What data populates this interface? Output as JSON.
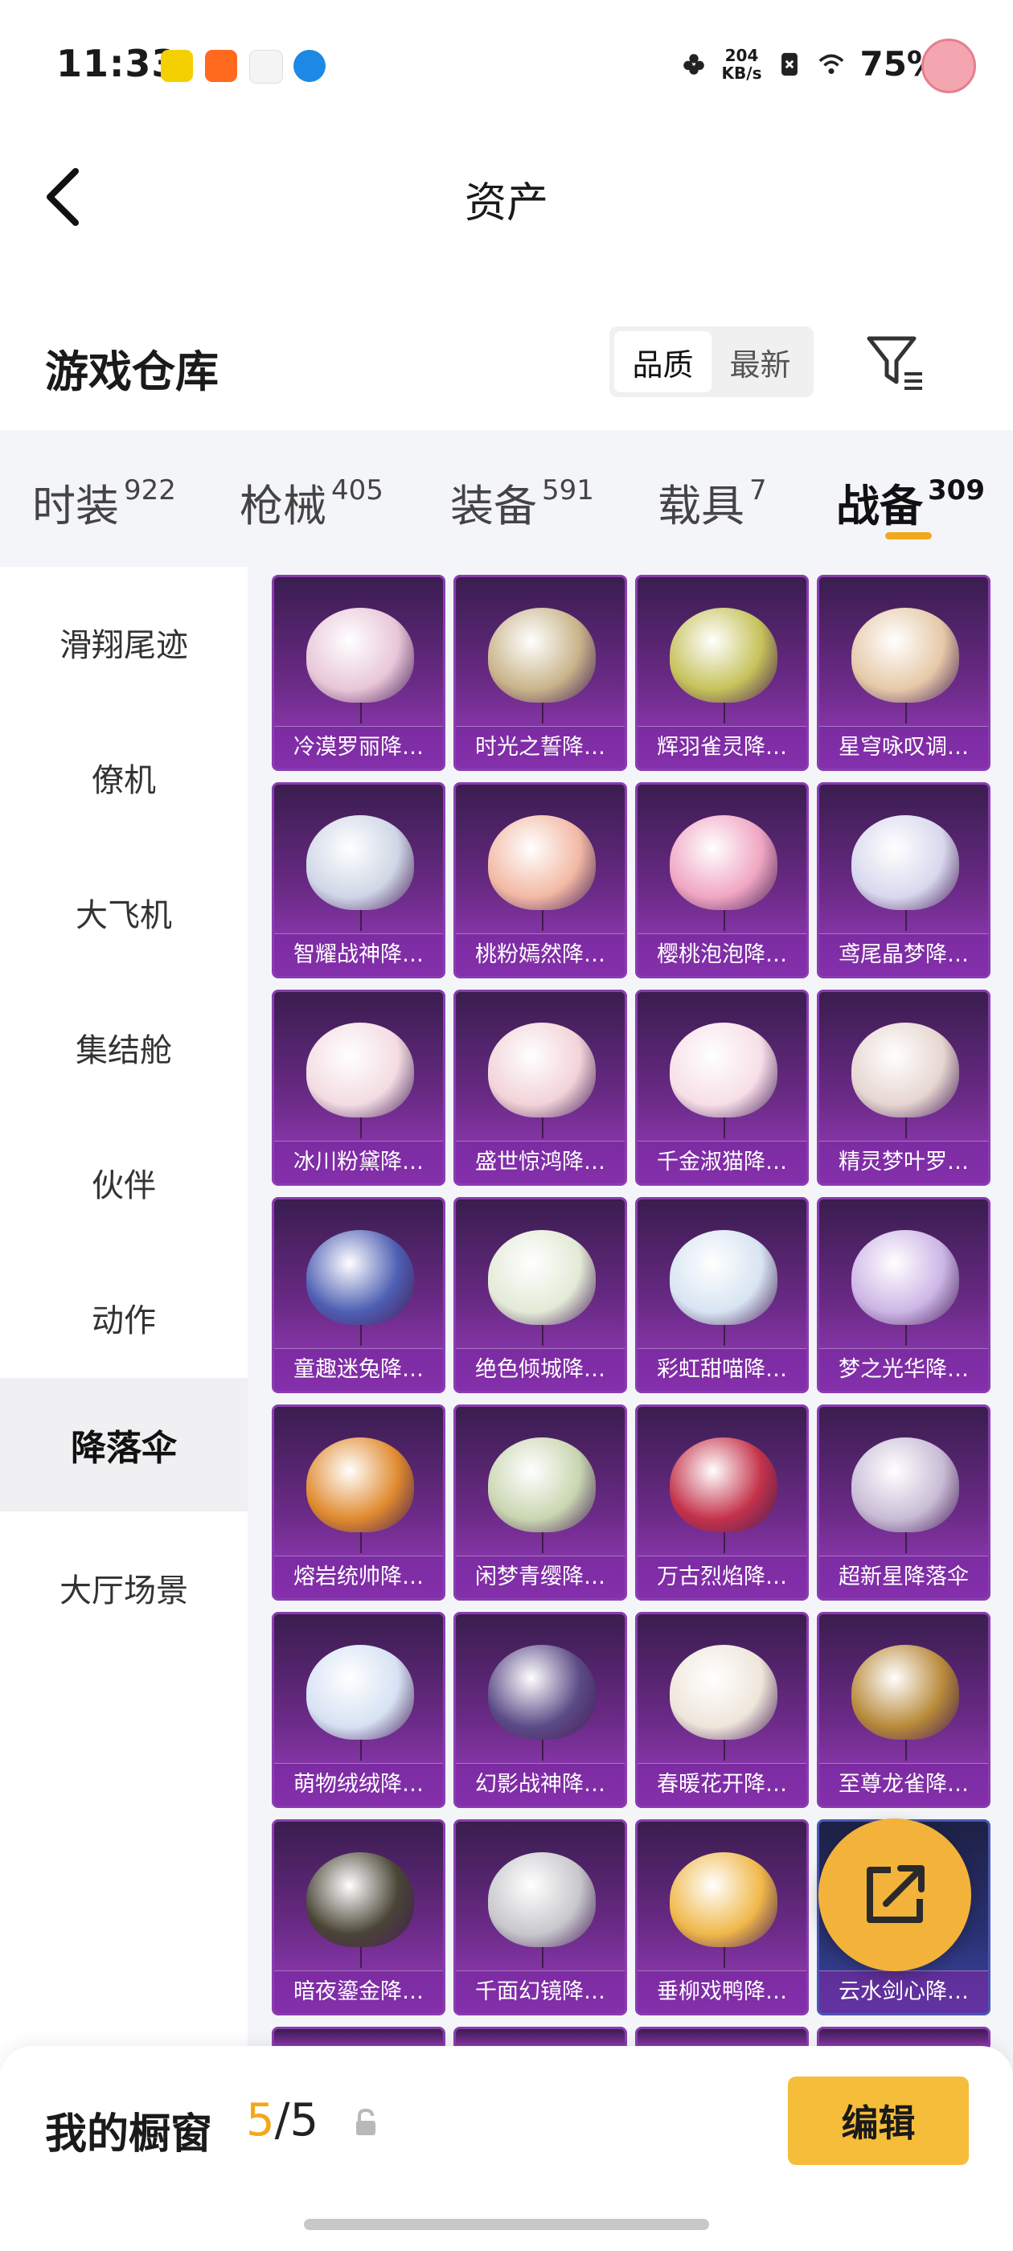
{
  "status_bar": {
    "time": "11:33",
    "net_speed_value": "204",
    "net_speed_unit": "KB/s",
    "battery": "75%"
  },
  "header": {
    "title": "资产",
    "back_icon": "chevron-left-icon"
  },
  "warehouse": {
    "title": "游戏仓库",
    "sort_options": [
      "品质",
      "最新"
    ],
    "sort_selected": "品质",
    "filter_icon": "filter-icon"
  },
  "tabs": [
    {
      "label": "时装",
      "count": "922"
    },
    {
      "label": "枪械",
      "count": "405"
    },
    {
      "label": "装备",
      "count": "591"
    },
    {
      "label": "载具",
      "count": "7"
    },
    {
      "label": "战备",
      "count": "309"
    }
  ],
  "active_tab": "战备",
  "side_nav": {
    "items": [
      "滑翔尾迹",
      "僚机",
      "大飞机",
      "集结舱",
      "伙伴",
      "动作",
      "降落伞",
      "大厅场景"
    ],
    "active": "降落伞"
  },
  "items": [
    {
      "name": "冷漠罗丽降…",
      "color": "#e8c6d8"
    },
    {
      "name": "时光之誓降…",
      "color": "#c9b48a"
    },
    {
      "name": "辉羽雀灵降…",
      "color": "#c6c25a"
    },
    {
      "name": "星穹咏叹调…",
      "color": "#e6c9a8"
    },
    {
      "name": "智耀战神降…",
      "color": "#cfd6e6"
    },
    {
      "name": "桃粉嫣然降…",
      "color": "#f2b9a4"
    },
    {
      "name": "樱桃泡泡降…",
      "color": "#f0a6c2"
    },
    {
      "name": "鸢尾晶梦降…",
      "color": "#d8d8ee"
    },
    {
      "name": "冰川粉黛降…",
      "color": "#f3dce2"
    },
    {
      "name": "盛世惊鸿降…",
      "color": "#f2d3d8"
    },
    {
      "name": "千金淑猫降…",
      "color": "#f7dfe8"
    },
    {
      "name": "精灵梦叶罗…",
      "color": "#e6d6d0"
    },
    {
      "name": "童趣迷兔降…",
      "color": "#4e5fb3"
    },
    {
      "name": "绝色倾城降…",
      "color": "#e3ead6"
    },
    {
      "name": "彩虹甜喵降…",
      "color": "#d7e4f2"
    },
    {
      "name": "梦之光华降…",
      "color": "#cdb6e6"
    },
    {
      "name": "熔岩统帅降…",
      "color": "#e08a2e"
    },
    {
      "name": "闲梦青缨降…",
      "color": "#c9d6b0"
    },
    {
      "name": "万古烈焰降…",
      "color": "#c4324a"
    },
    {
      "name": "超新星降落伞",
      "color": "#c9bcd6"
    },
    {
      "name": "萌物绒绒降…",
      "color": "#d6e2f4"
    },
    {
      "name": "幻影战神降…",
      "color": "#5b4b86"
    },
    {
      "name": "春暖花开降…",
      "color": "#efe6da"
    },
    {
      "name": "至尊龙雀降…",
      "color": "#b88a3a"
    },
    {
      "name": "暗夜鎏金降…",
      "color": "#4a4536"
    },
    {
      "name": "千面幻镜降…",
      "color": "#c8c8cc"
    },
    {
      "name": "垂柳戏鸭降…",
      "color": "#f0b84a"
    },
    {
      "name": "云水剑心降…",
      "color": "#7d87c4"
    }
  ],
  "share_icon": "share-external-icon",
  "bottom": {
    "label": "我的橱窗",
    "count_current": "5",
    "count_total": "/5",
    "lock_icon": "lock-icon",
    "edit_label": "编辑"
  }
}
